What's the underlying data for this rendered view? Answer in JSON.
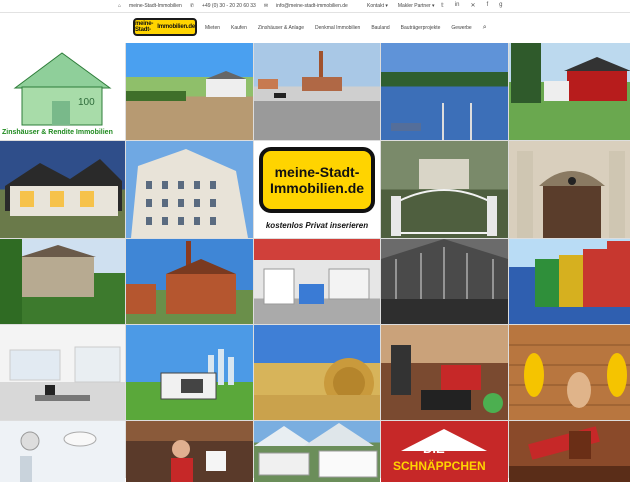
{
  "topbar": {
    "site_text": "meine-Stadt-Immobilien",
    "phone": "+49 (0) 30 - 20 20 60 33",
    "email": "info@meine-stadt-immobilien.de",
    "kontakt": "Kontakt",
    "makler_partner": "Makler Partner",
    "social_icons": [
      "twitter-icon",
      "linkedin-icon",
      "xing-icon",
      "facebook-icon",
      "google-plus-icon"
    ]
  },
  "logo": {
    "line1": "meine-Stadt-",
    "line2": "Immobilien.de"
  },
  "menu": {
    "items": [
      "Mieten",
      "Kaufen",
      "Zinshäuser & Anlage",
      "Denkmal Immobilien",
      "Bauland",
      "Bauträgerprojekte",
      "Gewerbe"
    ],
    "search_icon": "search-icon"
  },
  "tiles": {
    "t1_caption": "Zinshäuser & Rendite Immobilien",
    "money_label": "100",
    "logo_big_line1": "meine-Stadt-",
    "logo_big_line2": "Immobilien.de",
    "logo_big_sub": "kostenlos Privat inserieren",
    "die_text": "DIE",
    "schnappchen_text": "SCHNÄPPCHEN"
  },
  "colors": {
    "yellow": "#ffd400",
    "green_caption": "#1f8a1f"
  }
}
